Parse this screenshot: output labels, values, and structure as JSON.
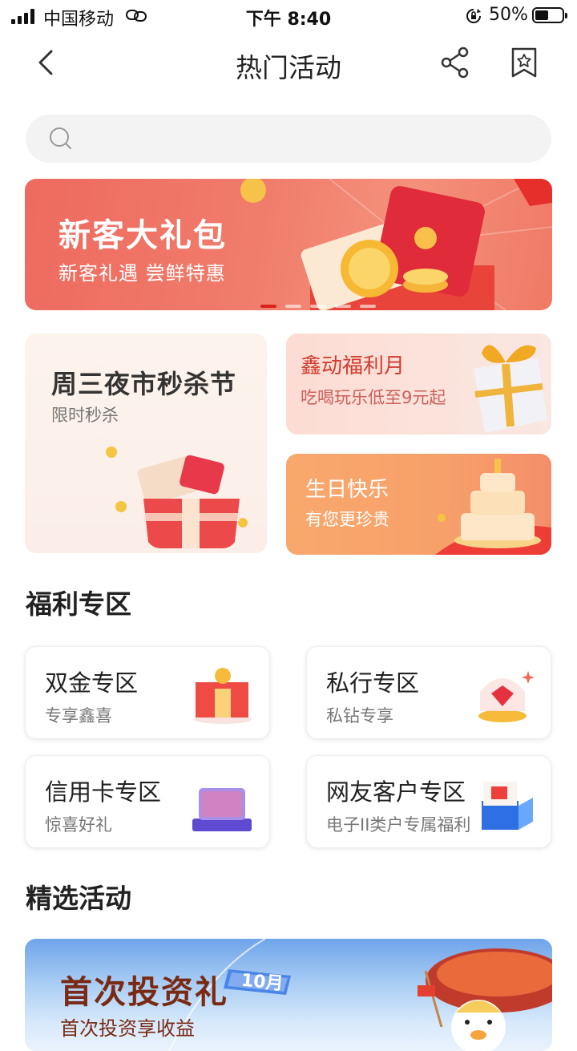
{
  "status_bar": {
    "carrier": "中国移动",
    "time": "下午 8:40",
    "battery": "50%",
    "battery_level": 0.5
  },
  "header": {
    "title": "热门活动"
  },
  "search": {
    "placeholder": ""
  },
  "banner": {
    "title": "新客大礼包",
    "subtitle": "新客礼遇 尝鲜特惠",
    "slide_count": 5,
    "active_slide": 0
  },
  "activities": {
    "big": {
      "title": "周三夜市秒杀节",
      "subtitle": "限时秒杀"
    },
    "fuli": {
      "title": "鑫动福利月",
      "subtitle": "吃喝玩乐低至9元起"
    },
    "birthday": {
      "title": "生日快乐",
      "subtitle": "有您更珍贵"
    }
  },
  "welfare_zone": {
    "title": "福利专区",
    "items": [
      {
        "title": "双金专区",
        "subtitle": "专享鑫喜"
      },
      {
        "title": "私行专区",
        "subtitle": "私钻专享"
      },
      {
        "title": "信用卡专区",
        "subtitle": "惊喜好礼"
      },
      {
        "title": "网友客户专区",
        "subtitle": "电子II类户专属福利"
      }
    ]
  },
  "featured": {
    "title": "精选活动",
    "card_title": "首次投资礼",
    "card_badge": "10月",
    "card_subtitle": "首次投资享收益"
  },
  "colors": {
    "accent_red": "#d8231b",
    "banner": "#ee6a5f",
    "birthday": "#f9a86c"
  }
}
